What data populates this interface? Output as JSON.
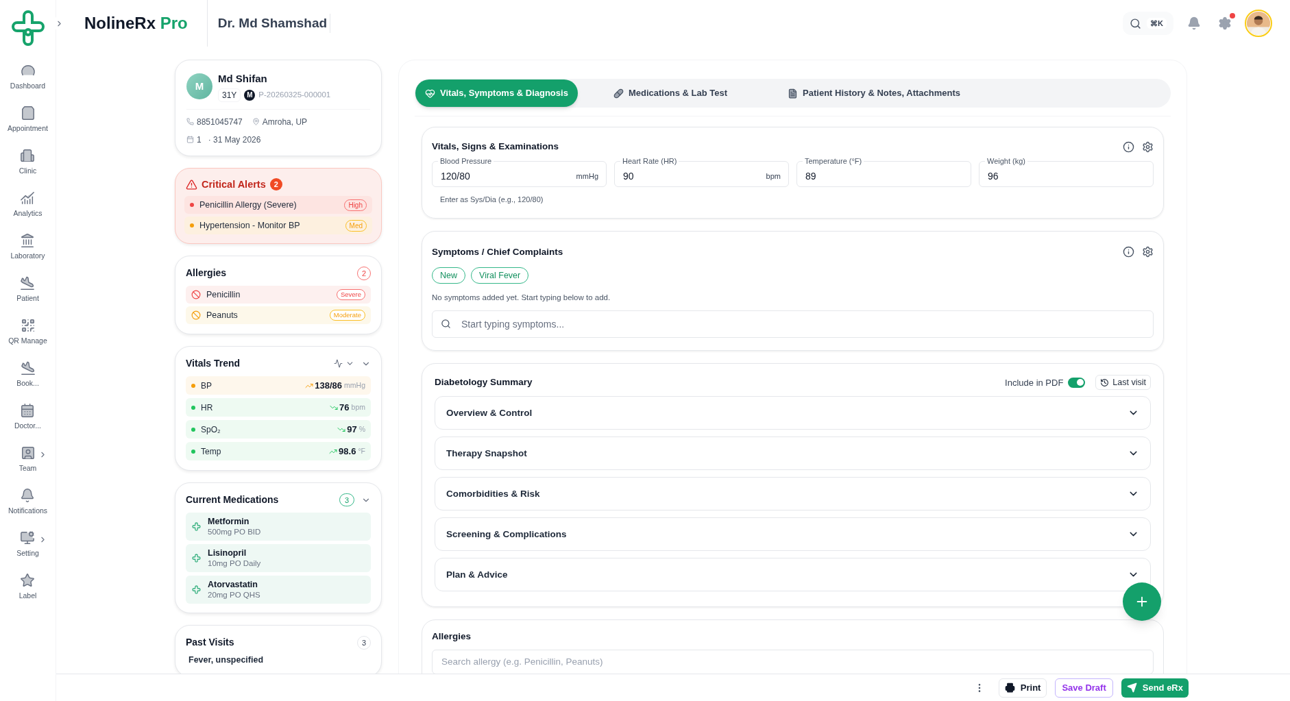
{
  "sidebar": {
    "items": [
      {
        "label": "Dashboard",
        "expandable": false
      },
      {
        "label": "Appointment",
        "expandable": false
      },
      {
        "label": "Clinic",
        "expandable": false
      },
      {
        "label": "Analytics",
        "expandable": false
      },
      {
        "label": "Laboratory",
        "expandable": false
      },
      {
        "label": "Patient",
        "expandable": false
      },
      {
        "label": "QR Manage",
        "expandable": false
      },
      {
        "label": "Book...",
        "expandable": false
      },
      {
        "label": "Doctor...",
        "expandable": false
      },
      {
        "label": "Team",
        "expandable": true
      },
      {
        "label": "Notifications",
        "expandable": false
      },
      {
        "label": "Setting",
        "expandable": true
      },
      {
        "label": "Label",
        "expandable": false
      }
    ]
  },
  "header": {
    "brand": "NolineRx",
    "brand_suffix": "Pro",
    "doctor": "Dr. Md Shamshad",
    "search_shortcut": "⌘K",
    "settings_alert": true
  },
  "patient": {
    "initial": "M",
    "name": "Md Shifan",
    "age": "31Y",
    "gender": "M",
    "patient_id": "P-20260325-000001",
    "phone": "8851045747",
    "location": "Amroha, UP",
    "visits": "1",
    "date": "· 31 May 2026"
  },
  "critical_alerts": {
    "title": "Critical Alerts",
    "count": "2",
    "items": [
      {
        "text": "Penicillin Allergy (Severe)",
        "badge": "High",
        "kind": "high"
      },
      {
        "text": "Hypertension - Monitor BP",
        "badge": "Med",
        "kind": "medium"
      }
    ]
  },
  "allergies": {
    "title": "Allergies",
    "count": "2",
    "items": [
      {
        "name": "Penicillin",
        "badge": "Severe",
        "kind": "severe"
      },
      {
        "name": "Peanuts",
        "badge": "Moderate",
        "kind": "moderate"
      }
    ]
  },
  "vitals_trend": {
    "title": "Vitals Trend",
    "rows": [
      {
        "label": "BP",
        "value": "138/86",
        "unit": "mmHg",
        "rising": true,
        "color": "#f59e0b"
      },
      {
        "label": "HR",
        "value": "76",
        "unit": "bpm",
        "rising": false,
        "color": "#22c55e"
      },
      {
        "label": "SpO₂",
        "value": "97",
        "unit": "%",
        "rising": false,
        "color": "#22c55e"
      },
      {
        "label": "Temp",
        "value": "98.6",
        "unit": "°F",
        "rising": true,
        "color": "#22c55e"
      }
    ]
  },
  "current_medications": {
    "title": "Current Medications",
    "count": "3",
    "items": [
      {
        "name": "Metformin",
        "dose": "500mg PO BID"
      },
      {
        "name": "Lisinopril",
        "dose": "10mg PO Daily"
      },
      {
        "name": "Atorvastatin",
        "dose": "20mg PO QHS"
      }
    ]
  },
  "past_visits": {
    "title": "Past Visits",
    "count": "3",
    "items": [
      {
        "diagnosis": "Fever, unspecified"
      }
    ]
  },
  "tabs": [
    {
      "label": "Vitals, Symptoms & Diagnosis",
      "selected": true
    },
    {
      "label": "Medications & Lab Test",
      "selected": false
    },
    {
      "label": "Patient History & Notes, Attachments",
      "selected": false
    }
  ],
  "vitals_section": {
    "title": "Vitals, Signs & Examinations",
    "fields": [
      {
        "label": "Blood Pressure",
        "value": "120/80",
        "unit": "mmHg"
      },
      {
        "label": "Heart Rate (HR)",
        "value": "90",
        "unit": "bpm"
      },
      {
        "label": "Temperature (°F)",
        "value": "89"
      },
      {
        "label": "Weight (kg)",
        "value": "96"
      }
    ],
    "hint": "Enter as Sys/Dia (e.g., 120/80)"
  },
  "symptoms_section": {
    "title": "Symptoms / Chief Complaints",
    "tags": [
      "New",
      "Viral Fever"
    ],
    "empty_text": "No symptoms added yet. Start typing below to add.",
    "search": {
      "placeholder": "Start typing symptoms..."
    }
  },
  "diabetology_section": {
    "title": "Diabetology Summary",
    "include_label": "Include in PDF",
    "include_on": true,
    "last_visit": "Last visit",
    "sections": [
      {
        "title": "Overview & Control",
        "expanded": false
      },
      {
        "title": "Therapy Snapshot",
        "expanded": false
      },
      {
        "title": "Comorbidities & Risk",
        "expanded": false
      },
      {
        "title": "Screening & Complications",
        "expanded": false
      },
      {
        "title": "Plan & Advice",
        "expanded": false
      }
    ]
  },
  "allergies_section": {
    "title": "Allergies",
    "search": {
      "placeholder": "Search allergy (e.g. Penicillin, Peanuts)"
    }
  },
  "footer": {
    "print": "Print",
    "save_draft": "Save Draft",
    "send": "Send eRx"
  }
}
